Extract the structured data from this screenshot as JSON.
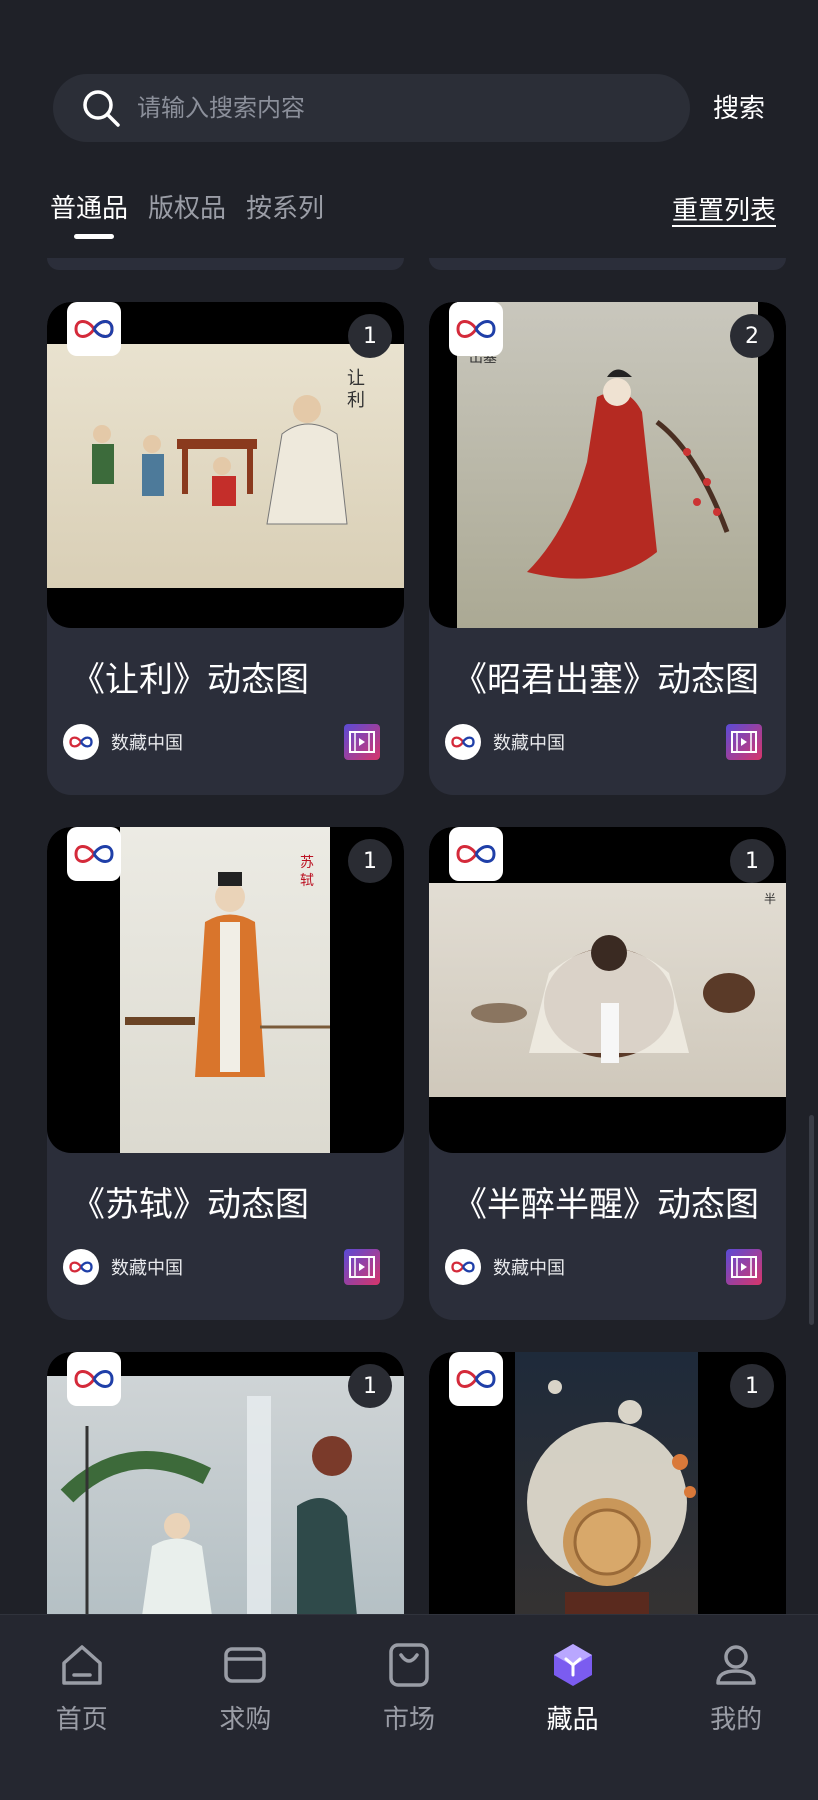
{
  "search": {
    "placeholder": "请输入搜索内容",
    "button_label": "搜索"
  },
  "tabs": [
    {
      "label": "普通品",
      "active": true
    },
    {
      "label": "版权品",
      "active": false
    },
    {
      "label": "按系列",
      "active": false
    }
  ],
  "reset_label": "重置列表",
  "items": [
    {
      "title": "《让利》动态图",
      "count": "1",
      "creator": "数藏中国"
    },
    {
      "title": "《昭君出塞》动态图",
      "count": "2",
      "creator": "数藏中国"
    },
    {
      "title": "《苏轼》动态图",
      "count": "1",
      "creator": "数藏中国"
    },
    {
      "title": "《半醉半醒》动态图",
      "count": "1",
      "creator": "数藏中国"
    },
    {
      "title": "",
      "count": "1",
      "creator": ""
    },
    {
      "title": "",
      "count": "1",
      "creator": ""
    }
  ],
  "nav": [
    {
      "label": "首页",
      "icon": "home-icon",
      "active": false
    },
    {
      "label": "求购",
      "icon": "wallet-icon",
      "active": false
    },
    {
      "label": "市场",
      "icon": "shopping-bag-icon",
      "active": false
    },
    {
      "label": "藏品",
      "icon": "collection-box-icon",
      "active": true
    },
    {
      "label": "我的",
      "icon": "profile-icon",
      "active": false
    }
  ],
  "colors": {
    "background": "#1f2128",
    "card": "#2b2e3a",
    "accent_purple": "#7b5cf0",
    "logo_red": "#d42a3a",
    "logo_blue": "#1f3fa8"
  }
}
